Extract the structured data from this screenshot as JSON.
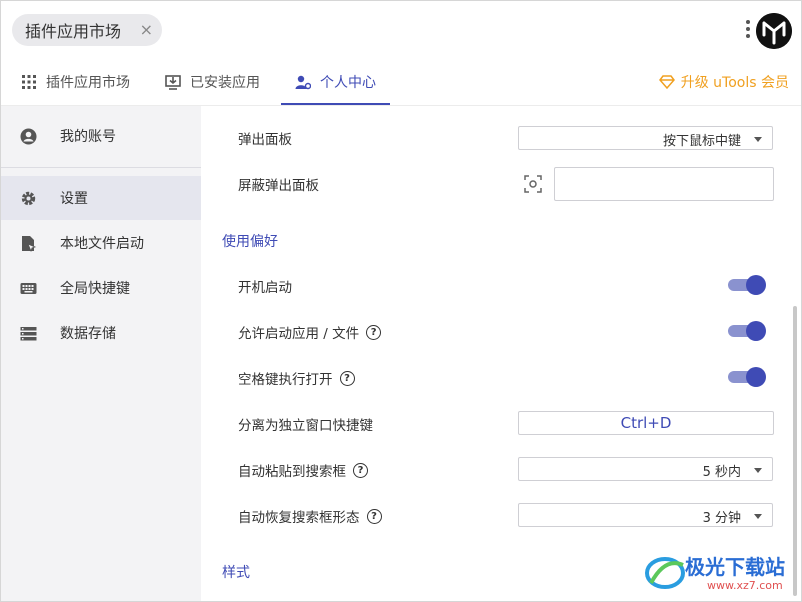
{
  "header": {
    "search_text": "插件应用市场",
    "close_symbol": "×"
  },
  "tabs": [
    {
      "label": "插件应用市场",
      "icon": "grid-icon",
      "active": false
    },
    {
      "label": "已安装应用",
      "icon": "installed-icon",
      "active": false
    },
    {
      "label": "个人中心",
      "icon": "user-gear-icon",
      "active": true
    }
  ],
  "upgrade": {
    "label": "升级 uTools 会员",
    "icon": "diamond-icon",
    "color": "#f0a020"
  },
  "sidebar": {
    "items": [
      {
        "label": "我的账号",
        "icon": "account-icon"
      },
      {
        "label": "设置",
        "icon": "gear-icon"
      },
      {
        "label": "本地文件启动",
        "icon": "file-launch-icon"
      },
      {
        "label": "全局快捷键",
        "icon": "keyboard-icon"
      },
      {
        "label": "数据存储",
        "icon": "storage-icon"
      }
    ],
    "active_index": 1
  },
  "settings": {
    "popup_panel": {
      "label": "弹出面板",
      "value": "按下鼠标中键"
    },
    "block_popup": {
      "label": "屏蔽弹出面板",
      "value": ""
    },
    "section_usage": "使用偏好",
    "auto_start": {
      "label": "开机启动",
      "on": true
    },
    "allow_launch": {
      "label": "允许启动应用 / 文件",
      "help": "?",
      "on": true
    },
    "space_open": {
      "label": "空格键执行打开",
      "help": "?",
      "on": true
    },
    "detach_hotkey": {
      "label": "分离为独立窗口快捷键",
      "value": "Ctrl+D"
    },
    "auto_paste": {
      "label": "自动粘贴到搜索框",
      "help": "?",
      "value": "5 秒内"
    },
    "auto_restore": {
      "label": "自动恢复搜索框形态",
      "help": "?",
      "value": "3 分钟"
    },
    "section_style": "样式"
  },
  "watermark": {
    "name": "极光下载站",
    "url": "www.xz7.com"
  },
  "colors": {
    "accent": "#3f4bb5",
    "sidebar_bg": "#f3f3f5",
    "toggle_track": "#8a92cf"
  }
}
